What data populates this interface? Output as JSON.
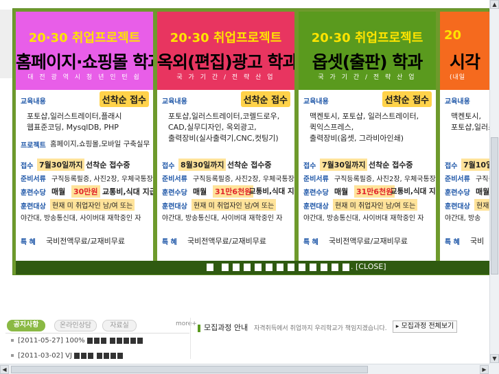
{
  "colors": {
    "frame": "#6e9a2c",
    "control_bar": "#2f5a11",
    "panel1_head": "#e85ee8",
    "panel2_head": "#e83560",
    "panel3_head": "#5a9a1e",
    "panel4_head": "#f56a1e",
    "head_top_text": "#ffe400",
    "label_blue": "#1f57a8",
    "price_red": "#e0242a",
    "highlight": "#ffe39a",
    "badge": "#ffd24a"
  },
  "popup": {
    "panels": [
      {
        "head_top": "20·30 취업프로젝트",
        "head_main": "홈페이지·쇼핑몰 학과",
        "head_sub": "대 전 광 역 시   청 년 인 턴 쉽",
        "badge": "선착순 접수",
        "label_content": "교육내용",
        "content_lines": [
          "포토샵,일러스트레이터,플래시",
          "웹표준코딩, MysqlDB, PHP"
        ],
        "label_project": "프로젝트",
        "project_text": "홈페이지,쇼핑몰,모바일 구축실무",
        "label_receipt": "접수",
        "receipt_date": "7월30일까지",
        "receipt_text": "선착순 접수중",
        "label_docs": "준비서류",
        "docs_text": "구직등록필증, 사진2장, 우체국통장",
        "label_allow": "훈련수당",
        "allow_prefix": "매월",
        "allow_amount": "30만원",
        "allow_suffix": "교통비,식대 지급",
        "label_target": "훈련대상",
        "target_line1": "현재 미 취업자인 남/여 또는",
        "target_line2": "야간대, 방송통신대, 사이버대 재학중인 자",
        "label_benefit": "특    혜",
        "benefit_text": "국비전액무료/교재비무료"
      },
      {
        "head_top": "20·30 취업프로젝트",
        "head_main": "옥외(편집)광고 학과",
        "head_sub": "국 가 기 간   /   전 략 산 업",
        "badge": "선착순 접수",
        "label_content": "교육내용",
        "content_lines": [
          "포토샵,일러스트레이터,코렐드로우,",
          "CAD,실무디자인, 옥외광고,",
          "출력장비(실사출력기,CNC,컷팅기)"
        ],
        "label_receipt": "접수",
        "receipt_date": "8월30일까지",
        "receipt_text": "선착순 접수중",
        "label_docs": "준비서류",
        "docs_text": "구직등록필증, 사진2장, 우체국통장",
        "label_allow": "훈련수당",
        "allow_prefix": "매월",
        "allow_amount": "31만6천원",
        "allow_suffix": "교통비,식대 지급",
        "label_target": "훈련대상",
        "target_line1": "현재 미 취업자인 남/여 또는",
        "target_line2": "야간대, 방송통신대, 사이버대 재학중인 자",
        "label_benefit": "특    혜",
        "benefit_text": "국비전액무료/교재비무료"
      },
      {
        "head_top": "20·30 취업프로젝트",
        "head_main": "옵셋(출판) 학과",
        "head_sub": "국 가 기 간   /   전 략 산 업",
        "badge": "선착순 접수",
        "label_content": "교육내용",
        "content_lines": [
          "맥켄토시, 포토샵, 일러스트레이터,",
          "퀵익스프레스,",
          "출력장비(옵셋, 그라비아인쇄)"
        ],
        "label_receipt": "접수",
        "receipt_date": "7월30일까지",
        "receipt_text": "선착순 접수중",
        "label_docs": "준비서류",
        "docs_text": "구직등록필증, 사진2장, 우체국통장",
        "label_allow": "훈련수당",
        "allow_prefix": "매월",
        "allow_amount": "31만6천원",
        "allow_suffix": "교통비,식대 지급",
        "label_target": "훈련대상",
        "target_line1": "현재 미 취업자인 남/여 또는",
        "target_line2": "야간대, 방송통신대, 사이버대 재학중인 자",
        "label_benefit": "특    혜",
        "benefit_text": "국비전액무료/교재비무료"
      },
      {
        "head_top": "20",
        "head_main": "시각",
        "head_sub": "(내일",
        "label_content": "교육내용",
        "content_lines": [
          "맥켄토시,",
          "포토샵,일러스"
        ],
        "label_receipt": "접수",
        "receipt_date": "7월10일까",
        "label_docs": "준비서류",
        "docs_text": "구직등",
        "label_allow": "훈련수당",
        "allow_prefix": "매월",
        "label_target": "훈련대상",
        "target_line1": "현재 미",
        "target_line2": "야간대, 방송",
        "label_benefit": "특    혜",
        "benefit_text": "국비"
      }
    ],
    "close_label": ". [CLOSE]"
  },
  "bottom": {
    "tabs": [
      "공지사항",
      "온라인상담",
      "자료실"
    ],
    "more": "more+",
    "notices": [
      {
        "date": "[2011-05-27] 100%"
      },
      {
        "date": "[2011-03-02] VJ"
      }
    ],
    "recruit_title": "모집과정 안내",
    "recruit_subtitle": "자격취득에서 취업까지 우리학교가 책임지겠습니다.",
    "recruit_all": "모집과정 전체보기"
  }
}
